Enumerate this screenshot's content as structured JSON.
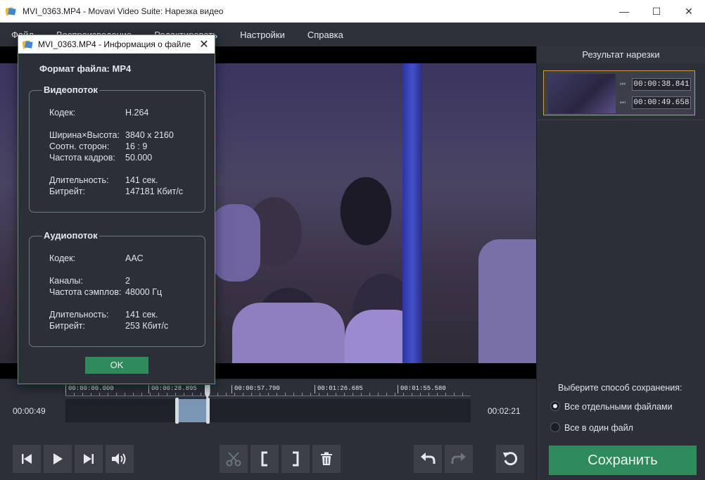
{
  "window": {
    "title": "MVI_0363.MP4 - Movavi Video Suite: Нарезка видео"
  },
  "menu": [
    "Файл",
    "Воспроизведение",
    "Редактировать",
    "Настройки",
    "Справка"
  ],
  "result_panel": {
    "title": "Результат нарезки",
    "clip": {
      "start": "00:00:38.841",
      "end": "00:00:49.658"
    }
  },
  "timeline": {
    "current_time": "00:00:49",
    "total_time": "00:02:21",
    "ticks": [
      "00:00:00.000",
      "00:00:28.895",
      "00:00:57.790",
      "00:01:26.685",
      "00:01:55.580"
    ],
    "selection": {
      "start_fraction": 0.275,
      "end_fraction": 0.352
    },
    "playhead_fraction": 0.35
  },
  "save_options": {
    "label": "Выберите способ сохранения:",
    "options": [
      {
        "label": "Все отдельными файлами",
        "selected": true
      },
      {
        "label": "Все в один файл",
        "selected": false
      }
    ],
    "save_button": "Сохранить"
  },
  "dialog": {
    "title": "MVI_0363.MP4 - Информация о файле",
    "format_line": "Формат файла:  MP4",
    "video": {
      "heading": "Видеопоток",
      "codec_label": "Кодек:",
      "codec": "H.264",
      "size_label": "Ширина×Высота:",
      "size": "3840 x 2160",
      "aspect_label": "Соотн. сторон:",
      "aspect": "16 : 9",
      "fps_label": "Частота кадров:",
      "fps": "50.000",
      "duration_label": "Длительность:",
      "duration": "141 сек.",
      "bitrate_label": "Битрейт:",
      "bitrate": "147181 Кбит/с"
    },
    "audio": {
      "heading": "Аудиопоток",
      "codec_label": "Кодек:",
      "codec": "AAC",
      "channels_label": "Каналы:",
      "channels": "2",
      "samplerate_label": "Частота сэмплов:",
      "samplerate": "48000 Гц",
      "duration_label": "Длительность:",
      "duration": "141 сек.",
      "bitrate_label": "Битрейт:",
      "bitrate": "253 Кбит/с"
    },
    "ok_button": "OK"
  },
  "icons": {
    "app": "movavi-logo-icon",
    "minimize": "minimize-icon",
    "maximize": "maximize-icon",
    "close": "close-icon"
  }
}
